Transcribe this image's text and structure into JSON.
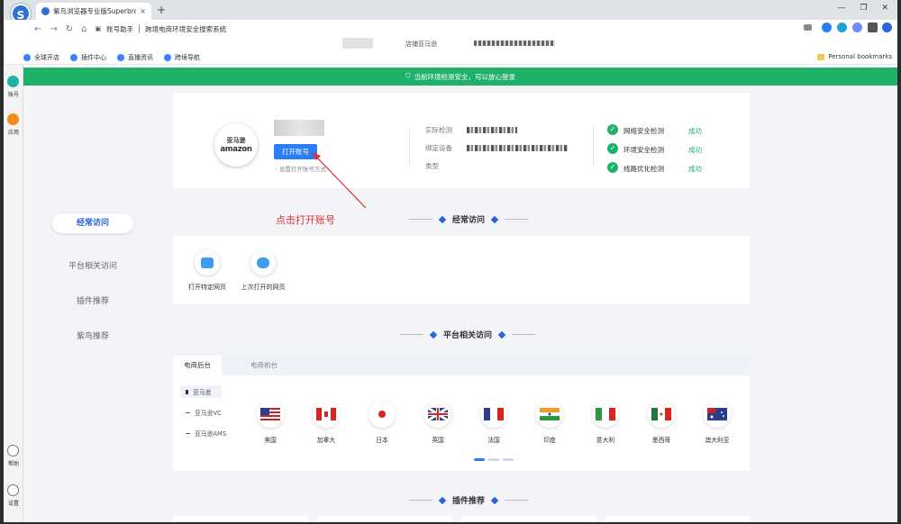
{
  "browser": {
    "tab_title": "紫鸟浏览器专业版Superbrowser",
    "tab_close": "×",
    "new_tab": "+",
    "window_controls": [
      "—",
      "❐",
      "✕"
    ],
    "url_prefix": "账号助手",
    "url_text": "跨境电商环境安全搜索系统",
    "nav": [
      "←",
      "→",
      "↻",
      "⌂"
    ]
  },
  "header2": {
    "label": "店铺亚马逊"
  },
  "bookmarks": {
    "items": [
      "全球开店",
      "插件中心",
      "直播资讯",
      "跨境导航"
    ],
    "personal": "Personal bookmarks"
  },
  "app_sidebar": {
    "items": [
      {
        "label": "账号"
      },
      {
        "label": "应用"
      },
      {
        "label": "帮助"
      },
      {
        "label": "设置"
      }
    ]
  },
  "banner": {
    "text": "当前环境检测安全，可以放心登录"
  },
  "account": {
    "logo_cn": "亚马逊",
    "logo_en": "amazon",
    "open_button": "打开账号",
    "setting_text": "设置打开账号方式",
    "fields": [
      {
        "label": "实际检测"
      },
      {
        "label": "绑定设备"
      },
      {
        "label": "类型"
      }
    ],
    "checks": [
      {
        "label": "网络安全检测",
        "status": "成功"
      },
      {
        "label": "环境安全检测",
        "status": "成功"
      },
      {
        "label": "线路优化检测",
        "status": "成功"
      }
    ],
    "status_color": "#1fb06a"
  },
  "annotation": {
    "text": "点击打开账号",
    "color": "#e03030"
  },
  "left_nav": {
    "items": [
      "经常访问",
      "平台相关访问",
      "插件推荐",
      "紫鸟推荐"
    ],
    "active": "经常访问"
  },
  "sections": {
    "frequent": "经常访问",
    "platform": "平台相关访问",
    "plugins": "插件推荐"
  },
  "quick_access": [
    {
      "label": "打开特定网页",
      "icon": "folder-icon"
    },
    {
      "label": "上次打开的网页",
      "icon": "cloud-icon"
    }
  ],
  "platform_tabs": [
    "电商后台",
    "电商前台"
  ],
  "sub_items": [
    "亚马逊",
    "亚马逊VC",
    "亚马逊AMS"
  ],
  "countries": [
    "美国",
    "加拿大",
    "日本",
    "英国",
    "法国",
    "印度",
    "意大利",
    "墨西哥",
    "澳大利亚"
  ],
  "accent_color": "#2a64d6"
}
